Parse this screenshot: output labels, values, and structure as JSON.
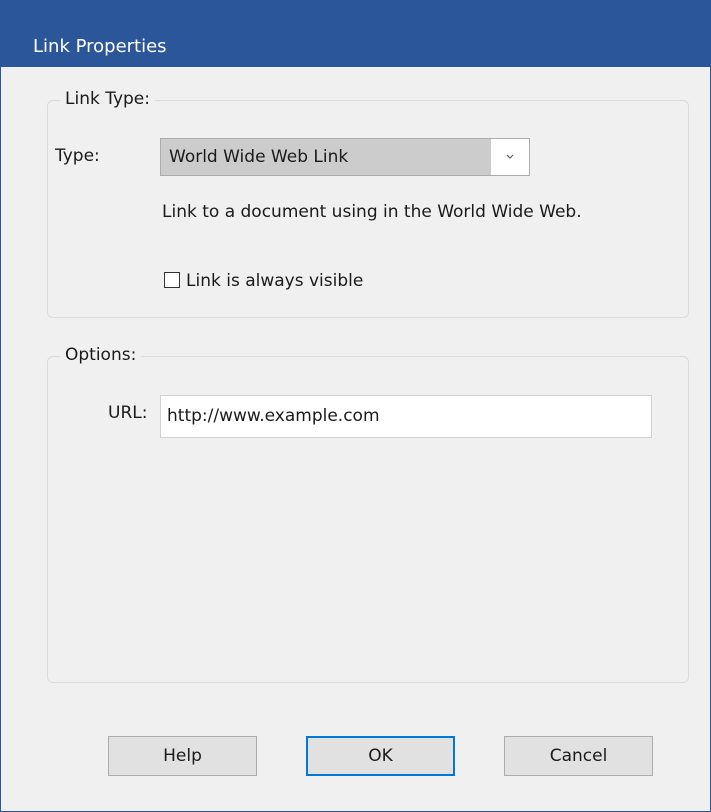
{
  "window": {
    "title": "Link Properties"
  },
  "link_type_group": {
    "title": "Link Type:",
    "type_label": "Type:",
    "type_value": "World Wide Web Link",
    "description": "Link to a document using in the World Wide Web.",
    "always_visible_label": "Link is always visible",
    "always_visible_checked": false
  },
  "options_group": {
    "title": "Options:",
    "url_label": "URL:",
    "url_value": "http://www.example.com"
  },
  "buttons": {
    "help": "Help",
    "ok": "OK",
    "cancel": "Cancel"
  },
  "icons": {
    "dropdown": "chevron-down-icon"
  },
  "colors": {
    "titlebar": "#2b579a",
    "dialog_background": "#f0f0f0",
    "default_button_border": "#0078d7"
  }
}
